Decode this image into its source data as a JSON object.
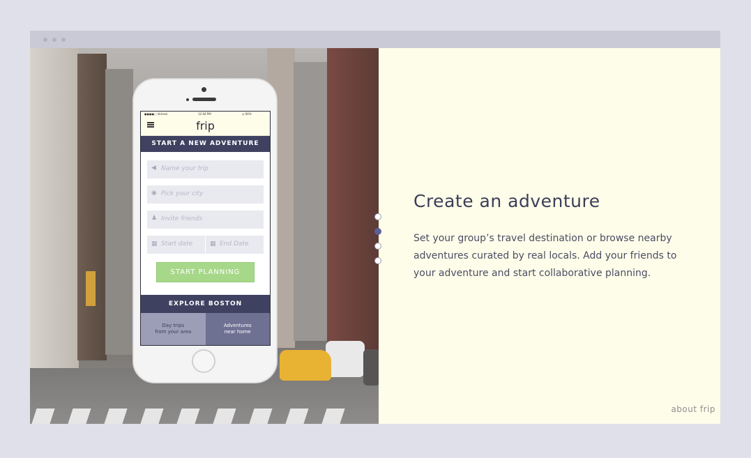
{
  "window": {
    "dots": [
      "dot",
      "dot",
      "dot"
    ]
  },
  "phone": {
    "statusbar": {
      "carrier": "●●●●○ Verizon",
      "time": "12:04 PM",
      "battery": "◎ 94%"
    },
    "app_logo": "frip",
    "start_section_title": "START A NEW ADVENTURE",
    "fields": {
      "trip_name_placeholder": "Name your trip",
      "city_placeholder": "Pick your city",
      "friends_placeholder": "Invite friends",
      "start_date_placeholder": "Start date",
      "end_date_placeholder": "End Date"
    },
    "cta_label": "START PLANNING",
    "explore_title": "EXPLORE BOSTON",
    "tiles": [
      {
        "line1": "Day trips",
        "line2": "from your area"
      },
      {
        "line1": "Adventures",
        "line2": "near home"
      }
    ]
  },
  "pager": {
    "count": 4,
    "active_index": 1
  },
  "content": {
    "headline": "Create an adventure",
    "description": "Set your group’s travel destination or browse nearby adventures curated by real locals. Add your friends to your adventure and start collaborative planning."
  },
  "footer": {
    "about_link": "about frip"
  },
  "colors": {
    "navy": "#3e4160",
    "accent_dot": "#5d6095",
    "cta_green": "#a7d889",
    "cream": "#fefdea",
    "page_bg": "#e0e0ea"
  },
  "icons": {
    "tag": "tag-icon",
    "location": "map-pin-icon",
    "add_user": "add-user-icon",
    "calendar": "calendar-icon",
    "menu": "hamburger-menu-icon"
  }
}
